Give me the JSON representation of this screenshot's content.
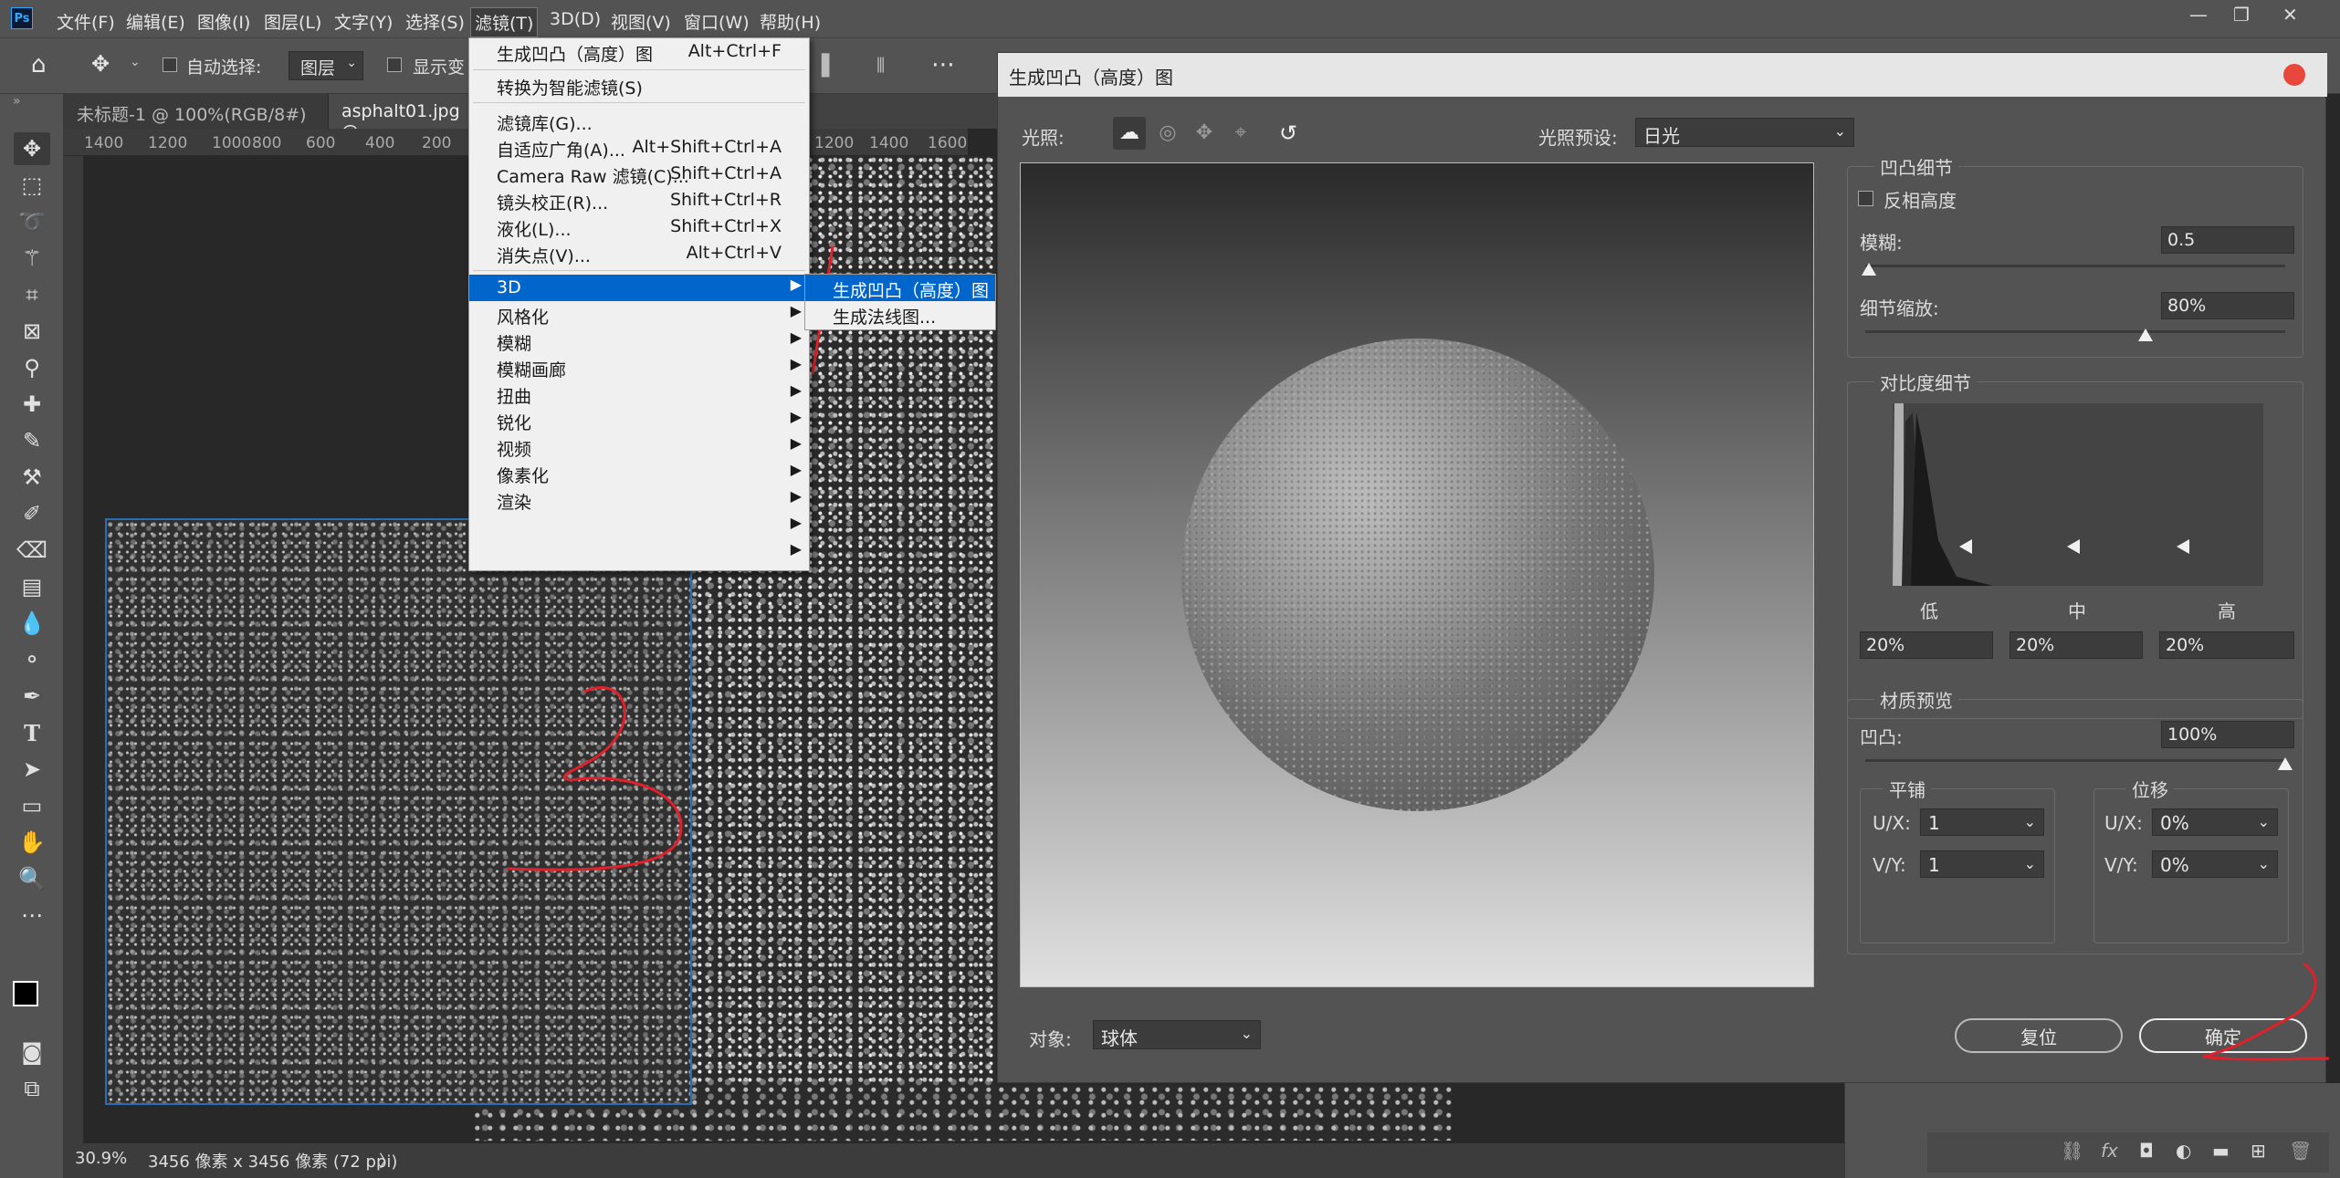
{
  "menubar": {
    "app_logo": "Ps",
    "items": [
      "文件(F)",
      "编辑(E)",
      "图像(I)",
      "图层(L)",
      "文字(Y)",
      "选择(S)",
      "滤镜(T)",
      "3D(D)",
      "视图(V)",
      "窗口(W)",
      "帮助(H)"
    ],
    "window_controls": [
      "—",
      "❐",
      "✕"
    ]
  },
  "options_bar": {
    "auto_select_label": "自动选择:",
    "auto_select_value": "图层",
    "show_transform_label": "显示变"
  },
  "tabs": [
    "未标题-1 @ 100%(RGB/8#) *",
    "asphalt01.jpg @"
  ],
  "ruler": [
    "1400",
    "1200",
    "1000",
    "800",
    "600",
    "400",
    "200",
    "1200",
    "1400",
    "1600"
  ],
  "statusbar": {
    "zoom": "30.9%",
    "doc_info": "3456 像素 x 3456 像素 (72 ppi)",
    "more": "〉"
  },
  "filter_menu": {
    "items": [
      {
        "label": "生成凹凸（高度）图",
        "shortcut": "Alt+Ctrl+F"
      },
      {
        "label": "转换为智能滤镜(S)",
        "shortcut": ""
      },
      {
        "label": "滤镜库(G)...",
        "shortcut": ""
      },
      {
        "label": "自适应广角(A)...",
        "shortcut": "Alt+Shift+Ctrl+A"
      },
      {
        "label": "Camera Raw 滤镜(C)...",
        "shortcut": "Shift+Ctrl+A"
      },
      {
        "label": "镜头校正(R)...",
        "shortcut": "Shift+Ctrl+R"
      },
      {
        "label": "液化(L)...",
        "shortcut": "Shift+Ctrl+X"
      },
      {
        "label": "消失点(V)...",
        "shortcut": "Alt+Ctrl+V"
      },
      {
        "label": "3D",
        "shortcut": ""
      },
      {
        "label": "风格化",
        "shortcut": ""
      },
      {
        "label": "模糊",
        "shortcut": ""
      },
      {
        "label": "模糊画廊",
        "shortcut": ""
      },
      {
        "label": "扭曲",
        "shortcut": ""
      },
      {
        "label": "锐化",
        "shortcut": ""
      },
      {
        "label": "视频",
        "shortcut": ""
      },
      {
        "label": "像素化",
        "shortcut": ""
      },
      {
        "label": "渲染",
        "shortcut": ""
      }
    ],
    "submenu_3d": [
      "生成凹凸（高度）图",
      "生成法线图..."
    ]
  },
  "dialog": {
    "title": "生成凹凸（高度）图",
    "lighting_label": "光照:",
    "lighting_preset_label": "光照预设:",
    "lighting_preset_value": "日光",
    "object_label": "对象:",
    "object_value": "球体",
    "bump_detail": {
      "title": "凹凸细节",
      "invert_label": "反相高度",
      "blur_label": "模糊:",
      "blur_value": "0.5",
      "detail_scale_label": "细节缩放:",
      "detail_scale_value": "80%"
    },
    "contrast_detail": {
      "title": "对比度细节",
      "low_label": "低",
      "mid_label": "中",
      "high_label": "高",
      "low_value": "20%",
      "mid_value": "20%",
      "high_value": "20%"
    },
    "material_preview": {
      "title": "材质预览",
      "bump_label": "凹凸:",
      "bump_value": "100%",
      "tile_title": "平铺",
      "offset_title": "位移",
      "ux_label": "U/X:",
      "vy_label": "V/Y:",
      "tile_ux": "1",
      "tile_vy": "1",
      "offset_ux": "0%",
      "offset_vy": "0%"
    },
    "reset_label": "复位",
    "ok_label": "确定"
  },
  "colors": {
    "accent": "#0066cc",
    "close": "#e8483c",
    "annotation": "#e0202a"
  }
}
